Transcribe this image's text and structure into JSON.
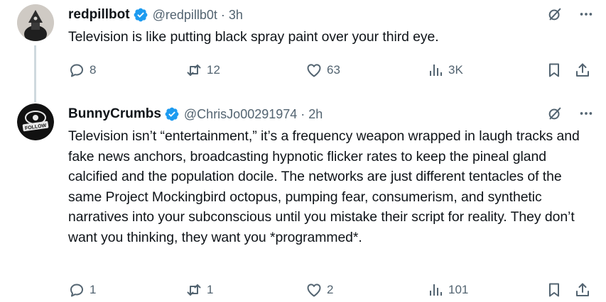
{
  "tweets": [
    {
      "display_name": "redpillbot",
      "handle": "@redpillb0t",
      "separator": "·",
      "time": "3h",
      "text": "Television is like putting black spray paint over your third eye.",
      "replies": "8",
      "retweets": "12",
      "likes": "63",
      "views": "3K"
    },
    {
      "display_name": "BunnyCrumbs",
      "handle": "@ChrisJo00291974",
      "separator": "·",
      "time": "2h",
      "text": "Television isn’t “entertainment,” it’s a frequency weapon wrapped in laugh tracks and fake news anchors, broadcasting hypnotic flicker rates to keep the pineal gland calcified and the population docile. The networks are just different tentacles of the same Project Mockingbird octopus, pumping fear, consumerism, and synthetic narratives into your subconscious until you mistake their script for reality. They don’t want you thinking, they want you *programmed*.",
      "replies": "1",
      "retweets": "1",
      "likes": "2",
      "views": "101",
      "avatar_text": "FOLLOW"
    }
  ],
  "colors": {
    "text": "#0f1419",
    "secondary": "#536471",
    "verified": "#1d9bf0",
    "thread_line": "#cfd9de"
  },
  "icons": {
    "verified": "verified-badge-icon",
    "grok": "grok-icon",
    "more": "more-icon",
    "reply": "reply-icon",
    "retweet": "retweet-icon",
    "like": "heart-icon",
    "views": "views-icon",
    "bookmark": "bookmark-icon",
    "share": "share-icon"
  }
}
